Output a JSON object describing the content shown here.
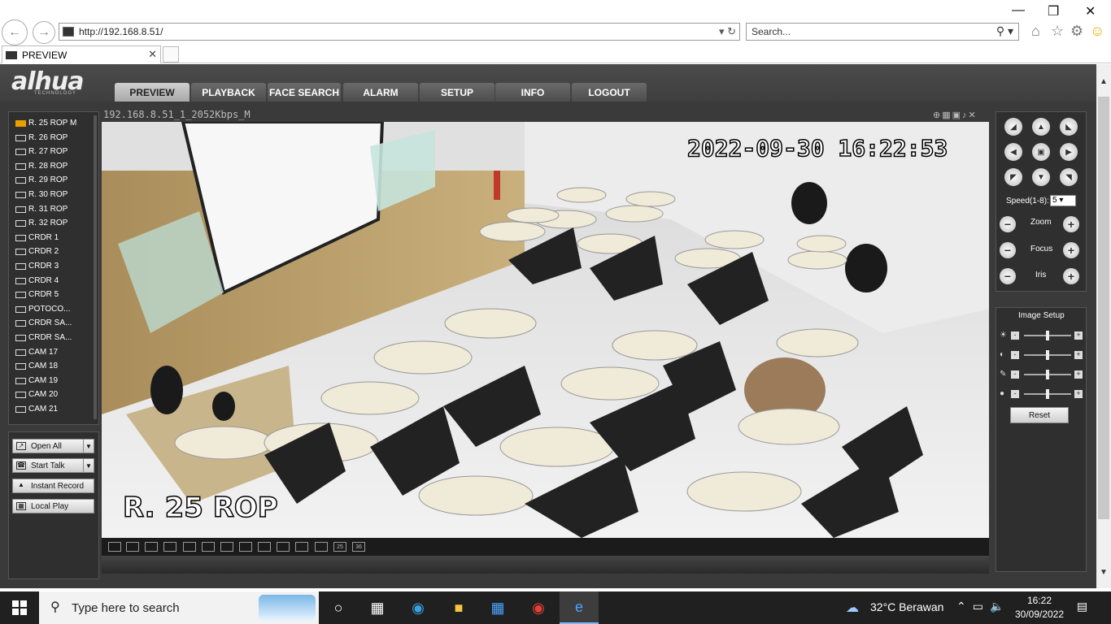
{
  "browser": {
    "url": "http://192.168.8.51/",
    "search_placeholder": "Search...",
    "tab_title": "PREVIEW"
  },
  "app": {
    "logo": "alhua",
    "logo_sub": "TECHNOLOGY",
    "menu": [
      "PREVIEW",
      "PLAYBACK",
      "FACE SEARCH",
      "ALARM",
      "SETUP",
      "INFO",
      "LOGOUT"
    ],
    "active_menu": "PREVIEW",
    "channels": [
      "R. 25 ROP   M",
      "R. 26 ROP",
      "R. 27 ROP",
      "R. 28 ROP",
      "R. 29 ROP",
      "R. 30 ROP",
      "R. 31 ROP",
      "R. 32 ROP",
      "CRDR 1",
      "CRDR 2",
      "CRDR 3",
      "CRDR 4",
      "CRDR 5",
      "POTOCO...",
      "CRDR SA...",
      "CRDR SA...",
      "CAM 17",
      "CAM 18",
      "CAM 19",
      "CAM 20",
      "CAM 21"
    ],
    "tools": {
      "open_all": "Open All",
      "start_talk": "Start Talk",
      "instant_record": "Instant Record",
      "local_play": "Local Play"
    },
    "video": {
      "title": "192.168.8.51_1_2052Kbps_M",
      "timestamp": "2022-09-30 16:22:53",
      "camera_label": "R. 25 ROP"
    },
    "layouts": [
      "",
      "",
      "",
      "",
      "",
      "",
      "",
      "",
      "",
      "",
      "",
      "",
      "",
      "25",
      "36"
    ],
    "ptz": {
      "speed_label": "Speed(1-8):",
      "speed_value": "5",
      "zoom": "Zoom",
      "focus": "Focus",
      "iris": "Iris"
    },
    "image_setup": {
      "title": "Image Setup",
      "reset": "Reset",
      "levels": [
        0.5,
        0.5,
        0.5,
        0.5
      ]
    }
  },
  "taskbar": {
    "search_placeholder": "Type here to search",
    "weather": "32°C  Berawan",
    "time": "16:22",
    "date": "30/09/2022"
  }
}
